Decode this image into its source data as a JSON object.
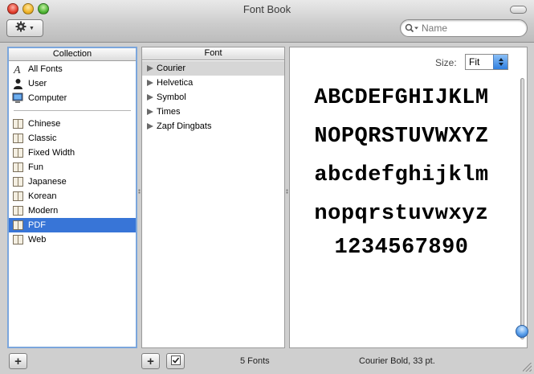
{
  "window": {
    "title": "Font Book"
  },
  "search": {
    "placeholder": "Name"
  },
  "collection_pane": {
    "header": "Collection",
    "top_items": [
      {
        "label": "All Fonts",
        "icon": "all-fonts-icon"
      },
      {
        "label": "User",
        "icon": "user-icon"
      },
      {
        "label": "Computer",
        "icon": "computer-icon"
      }
    ],
    "items": [
      "Chinese",
      "Classic",
      "Fixed Width",
      "Fun",
      "Japanese",
      "Korean",
      "Modern",
      "PDF",
      "Web"
    ],
    "selected": "PDF"
  },
  "font_pane": {
    "header": "Font",
    "items": [
      "Courier",
      "Helvetica",
      "Symbol",
      "Times",
      "Zapf Dingbats"
    ],
    "highlighted": "Courier"
  },
  "preview": {
    "size_label": "Size:",
    "size_value": "Fit",
    "sample_lines": [
      "ABCDEFGHIJKLM",
      "NOPQRSTUVWXYZ",
      "abcdefghijklm",
      "nopqrstuvwxyz",
      "1234567890"
    ],
    "slider_level": 1.0
  },
  "status": {
    "font_count": "5 Fonts",
    "font_info": "Courier Bold, 33 pt."
  },
  "colors": {
    "selection": "#3875d7",
    "focus_ring": "#7ba6dc"
  }
}
